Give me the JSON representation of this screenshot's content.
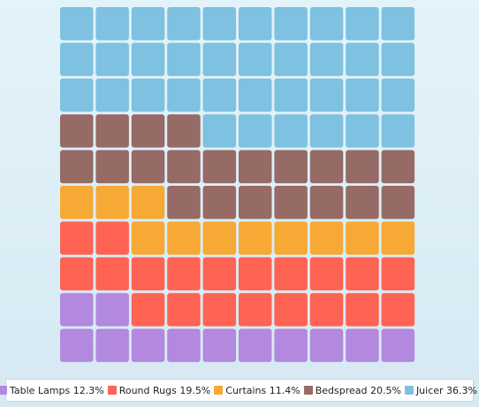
{
  "chart_data": {
    "type": "waffle",
    "grid": {
      "rows": 10,
      "cols": 10,
      "fill_order": "bottom-left, row by row upward"
    },
    "series": [
      {
        "name": "Table Lamps",
        "label": "Table Lamps 12.3%",
        "percent": 12.3,
        "cells": 12,
        "color": "#b388df"
      },
      {
        "name": "Round Rugs",
        "label": "Round Rugs 19.5%",
        "percent": 19.5,
        "cells": 20,
        "color": "#ff6353"
      },
      {
        "name": "Curtains",
        "label": "Curtains 11.4%",
        "percent": 11.4,
        "cells": 11,
        "color": "#f6a935"
      },
      {
        "name": "Bedspread",
        "label": "Bedspread 20.5%",
        "percent": 20.5,
        "cells": 21,
        "color": "#966a65"
      },
      {
        "name": "Juicer",
        "label": "Juicer 36.3%",
        "percent": 36.3,
        "cells": 36,
        "color": "#7ec1e0"
      }
    ],
    "legend": {
      "position": "bottom"
    },
    "title": "",
    "xlabel": "",
    "ylabel": ""
  }
}
